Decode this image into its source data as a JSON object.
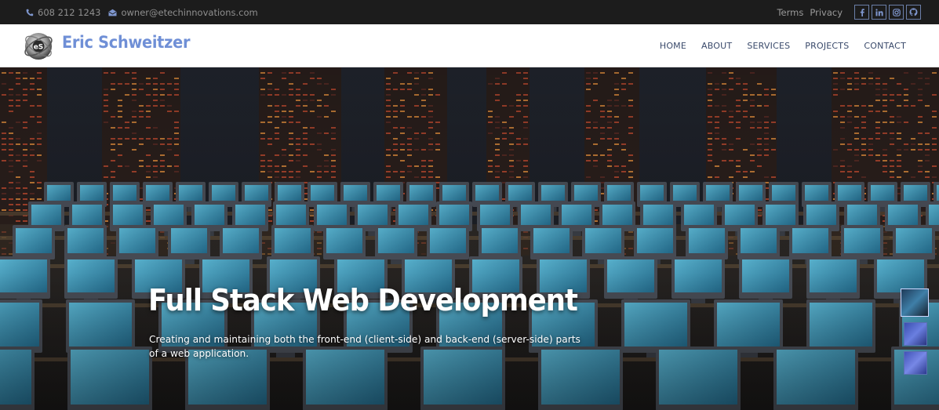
{
  "topbar": {
    "phone": "608 212 1243",
    "email": "owner@etechinnovations.com",
    "links": [
      "Terms",
      "Privacy"
    ],
    "social_icons": [
      "facebook-icon",
      "linkedin-icon",
      "instagram-icon",
      "github-icon"
    ]
  },
  "header": {
    "brand": "Eric Schweitzer",
    "nav": [
      "HOME",
      "ABOUT",
      "SERVICES",
      "PROJECTS",
      "CONTACT"
    ]
  },
  "hero": {
    "title": "Full Stack Web Development",
    "subtitle": "Creating and maintaining both the front-end (client-side) and back-end (server-side) parts of a web application.",
    "slides": 3,
    "active_slide": 1
  },
  "colors": {
    "accent": "#6f8fd6",
    "topbar_bg": "#1c1c1c",
    "nav_text": "#3a4a6b"
  }
}
